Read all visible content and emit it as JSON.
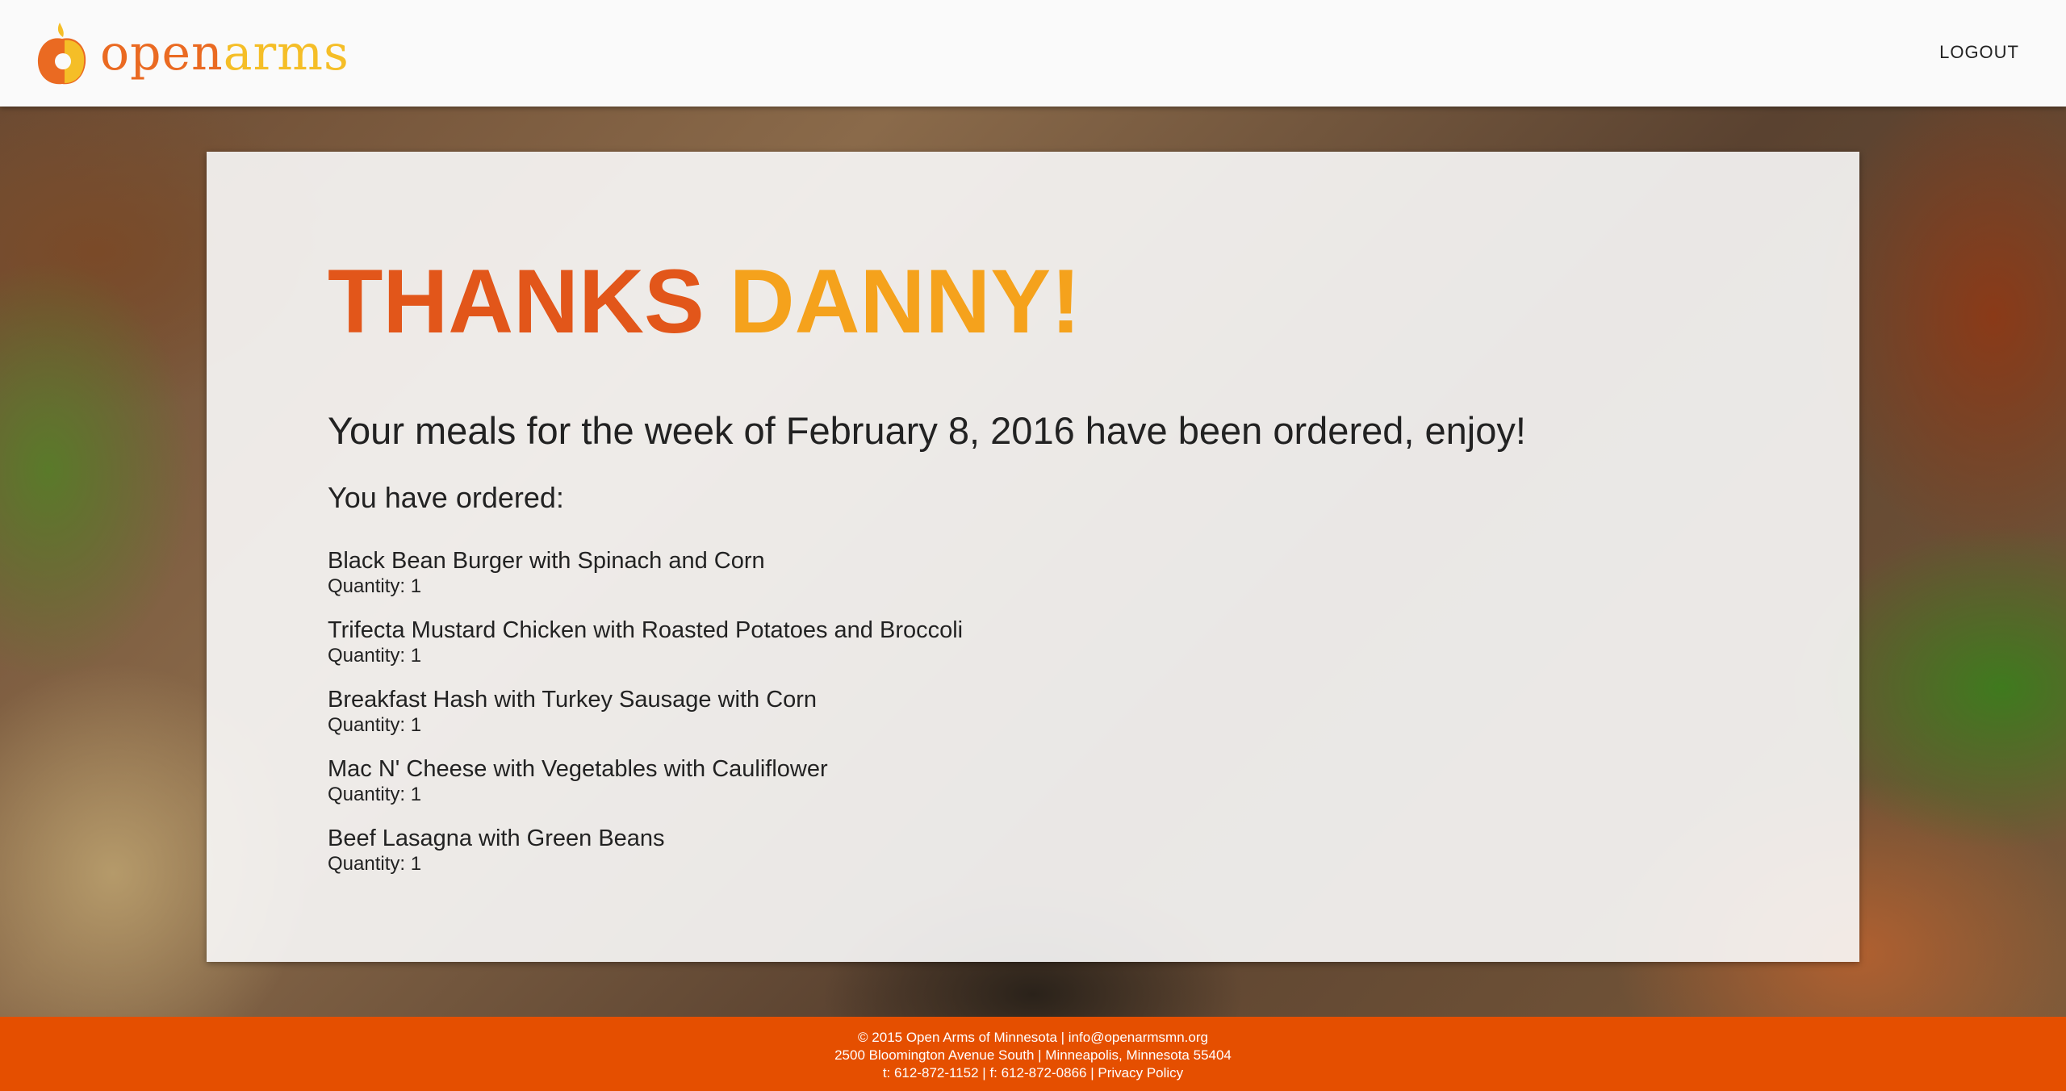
{
  "header": {
    "logo": {
      "text_open": "open",
      "text_arms": "arms",
      "icon": "apple-logo-icon"
    },
    "logout_label": "LOGOUT"
  },
  "card": {
    "headline_thanks": "THANKS",
    "headline_name": "DANNY!",
    "week_message": "Your meals for the week of February 8, 2016 have been ordered, enjoy!",
    "ordered_label": "You have ordered:",
    "items": [
      {
        "name": "Black Bean Burger with Spinach and Corn",
        "quantity": "Quantity: 1"
      },
      {
        "name": "Trifecta Mustard Chicken with Roasted Potatoes and Broccoli",
        "quantity": "Quantity: 1"
      },
      {
        "name": "Breakfast Hash with Turkey Sausage with Corn",
        "quantity": "Quantity: 1"
      },
      {
        "name": "Mac N' Cheese with Vegetables with Cauliflower",
        "quantity": "Quantity: 1"
      },
      {
        "name": "Beef Lasagna with Green Beans",
        "quantity": "Quantity: 1"
      }
    ]
  },
  "footer": {
    "copyright": "© 2015 Open Arms of Minnesota | ",
    "email": "info@openarmsmn.org",
    "address": "2500 Bloomington Avenue South | Minneapolis, Minnesota 55404",
    "phones": "t: 612-872-1152 | f: 612-872-0866 | ",
    "privacy_label": "Privacy Policy"
  },
  "colors": {
    "brand_orange": "#e2561a",
    "brand_yellow": "#f5a21c",
    "footer_bg": "#e54f00"
  }
}
